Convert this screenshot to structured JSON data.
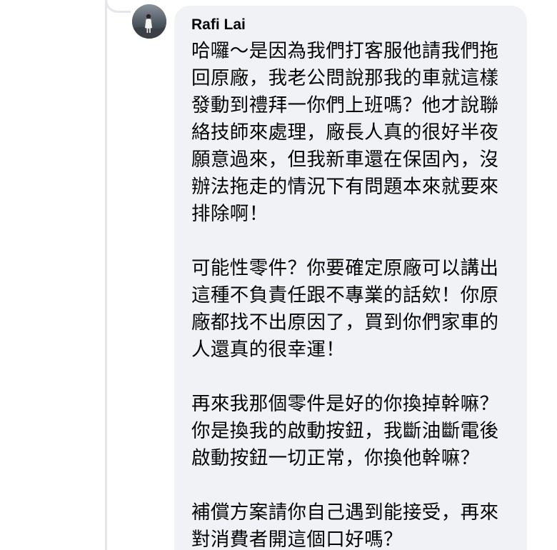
{
  "comment": {
    "author": "Rafi Lai",
    "paragraphs": [
      {
        "lines": [
          "哈囉～是因為我們打客服他請我們拖",
          "回原廠，我老公問說那我的車就這樣",
          "發動到禮拜一你們上班嗎？他才說聯",
          "絡技師來處理，廠長人真的很好半夜",
          "願意過來，但我新車還在保固內，沒",
          "辦法拖走的情況下有問題本來就要來",
          "排除啊！"
        ]
      },
      {
        "lines": [
          "可能性零件？你要確定原廠可以講出",
          "這種不負責任跟不專業的話欸！你原",
          "廠都找不出原因了，買到你們家車的",
          "人還真的很幸運！"
        ]
      },
      {
        "lines": [
          "再來我那個零件是好的你換掉幹嘛？",
          "你是換我的啟動按鈕，我斷油斷電後",
          "啟動按鈕一切正常，你換他幹嘛？"
        ]
      },
      {
        "lines": [
          "補償方案請你自己遇到能接受，再來",
          "對消費者開這個口好嗎？"
        ]
      }
    ]
  },
  "colors": {
    "bubble_background": "#f0f2f5",
    "text": "#050505",
    "thread_line": "#e4e6eb"
  },
  "icons": {
    "avatar": "profile-photo-avatar"
  }
}
